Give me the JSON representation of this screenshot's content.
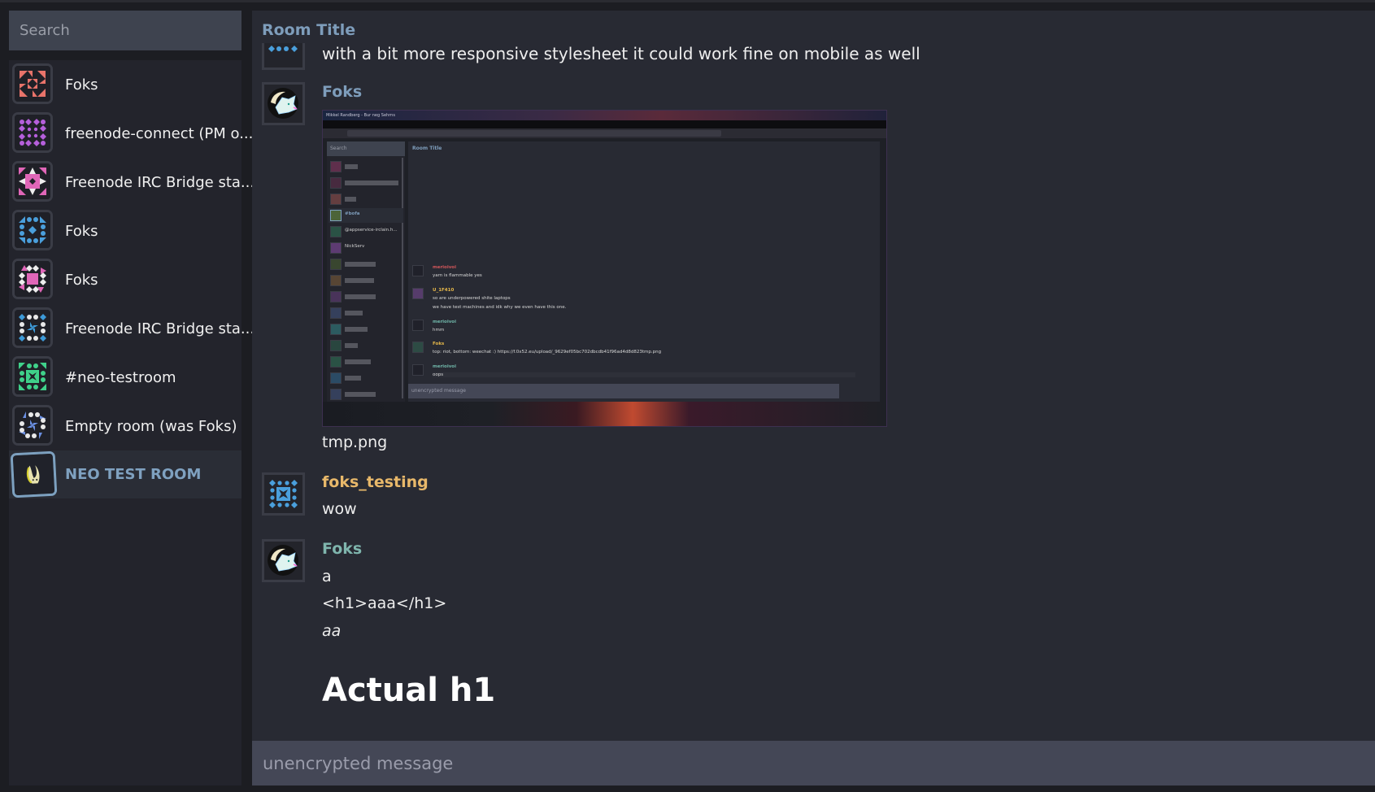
{
  "sidebar": {
    "search_placeholder": "Search",
    "rooms": [
      {
        "name": "Foks",
        "avatar": "identicon-red-triangles",
        "selected": false
      },
      {
        "name": "freenode-connect (PM o...",
        "avatar": "identicon-purple-dots",
        "selected": false
      },
      {
        "name": "Freenode IRC Bridge sta...",
        "avatar": "identicon-pink-diamond",
        "selected": false
      },
      {
        "name": "Foks",
        "avatar": "identicon-blue-dots",
        "selected": false
      },
      {
        "name": "Foks",
        "avatar": "identicon-pink-square",
        "selected": false
      },
      {
        "name": "Freenode IRC Bridge sta...",
        "avatar": "identicon-blue-white-dots",
        "selected": false
      },
      {
        "name": "#neo-testroom",
        "avatar": "identicon-green-square",
        "selected": false
      },
      {
        "name": "Empty room (was Foks)",
        "avatar": "identicon-lavender-dots",
        "selected": false
      },
      {
        "name": "NEO TEST ROOM",
        "avatar": "room-avatar-image",
        "selected": true
      }
    ]
  },
  "main": {
    "room_title": "Room Title",
    "messages": [
      {
        "sender": "",
        "sender_color": "",
        "lines": [
          "with a bit more responsive stylesheet it could work fine on mobile as well"
        ],
        "avatar": "identicon-blue"
      },
      {
        "sender": "Foks",
        "sender_color": "#7e9dbb",
        "image_caption": "tmp.png",
        "avatar": "fox-avatar"
      },
      {
        "sender": "foks_testing",
        "sender_color": "#e8b86a",
        "lines": [
          "wow"
        ],
        "avatar": "identicon-blue-square"
      },
      {
        "sender": "Foks",
        "sender_color": "#7fb5ad",
        "lines": [
          "a",
          "<h1>aaa</h1>",
          "aa"
        ],
        "heading": "Actual h1",
        "avatar": "fox-avatar"
      }
    ],
    "composer_placeholder": "unencrypted message"
  },
  "embedded_screenshot": {
    "window_title": "Mikkel Randberg - Bur neg Sehrns",
    "room_title": "Room Title",
    "search_placeholder": "Search",
    "rooms": [
      "",
      "",
      "",
      "#bofa",
      "@appservice-irclain.h...",
      "NickServ",
      "",
      "",
      "",
      "",
      "",
      "",
      "",
      "",
      ""
    ],
    "messages": [
      {
        "sender": "merioivoi",
        "color": "#d0565a",
        "lines": [
          "yarn is flammable yes"
        ]
      },
      {
        "sender": "U_1F410",
        "color": "#e6b84a",
        "lines": [
          "so are underpowered shite laptops",
          "we have test machines and idk why we even have this one."
        ]
      },
      {
        "sender": "merioivoi",
        "color": "#6fb5a8",
        "lines": [
          "hmm"
        ]
      },
      {
        "sender": "Foks",
        "color": "#e6b84a",
        "lines": [
          "top: riot, bottom: weechat :) https://f.0x52.eu/upload/_9629ef05bc702dbcdb41f96ad4d8d823tmp.png"
        ]
      },
      {
        "sender": "merioivoi",
        "color": "#6fb5a8",
        "lines": [
          "oops"
        ]
      }
    ],
    "composer_placeholder": "unencrypted message"
  },
  "colors": {
    "background": "#1c1d22",
    "sidebar": "#23242c",
    "main": "#282a33",
    "input": "#444756",
    "accent": "#7e9dbb"
  }
}
